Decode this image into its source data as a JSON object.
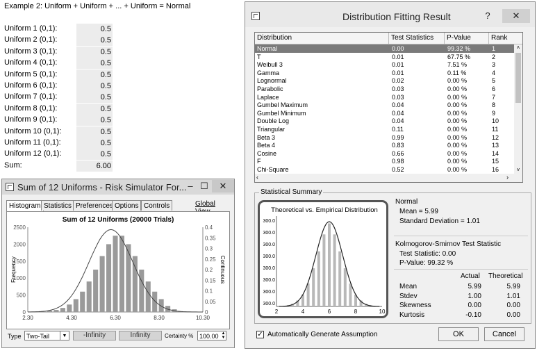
{
  "sheet": {
    "title": "Example 2: Uniform + Uniform + ... + Uniform = Normal",
    "rows": [
      {
        "label": "Uniform 1 (0,1):",
        "value": "0.5"
      },
      {
        "label": "Uniform 2 (0,1):",
        "value": "0.5"
      },
      {
        "label": "Uniform 3 (0,1):",
        "value": "0.5"
      },
      {
        "label": "Uniform 4 (0,1):",
        "value": "0.5"
      },
      {
        "label": "Uniform 5 (0,1):",
        "value": "0.5"
      },
      {
        "label": "Uniform 6 (0,1):",
        "value": "0.5"
      },
      {
        "label": "Uniform 7 (0,1):",
        "value": "0.5"
      },
      {
        "label": "Uniform 8 (0,1):",
        "value": "0.5"
      },
      {
        "label": "Uniform 9 (0,1):",
        "value": "0.5"
      },
      {
        "label": "Uniform 10 (0,1):",
        "value": "0.5"
      },
      {
        "label": "Uniform 11 (0,1):",
        "value": "0.5"
      },
      {
        "label": "Uniform 12 (0,1):",
        "value": "0.5"
      }
    ],
    "sum_label": "Sum:",
    "sum_value": "6.00"
  },
  "forecast": {
    "title": "Sum of 12 Uniforms - Risk Simulator For...",
    "minimize": "–",
    "maximize": "☐",
    "close": "✕",
    "tabs": [
      "Histogram",
      "Statistics",
      "Preferences",
      "Options",
      "Controls"
    ],
    "global_view": "Global View",
    "chart_title": "Sum of 12 Uniforms (20000 Trials)",
    "ylabel": "Frequency",
    "y2label": "Continuous",
    "yticks": [
      "2500",
      "2000",
      "1500",
      "1000",
      "500",
      "0"
    ],
    "y2ticks": [
      "0.4",
      "0.35",
      "0.3",
      "0.25",
      "0.2",
      "0.15",
      "0.1",
      "0.05",
      "0"
    ],
    "xticks": [
      "2.30",
      "4.30",
      "6.30",
      "8.30",
      "10.30"
    ],
    "type_label": "Type",
    "type_value": "Two-Tail",
    "lower_value": "-Infinity",
    "upper_value": "Infinity",
    "certainty_label": "Certainty %",
    "certainty_value": "100.00",
    "colors": {
      "bars": "#9a9a9a",
      "curve": "#444444"
    }
  },
  "fit": {
    "title": "Distribution Fitting Result",
    "help": "?",
    "close": "✕",
    "columns": [
      "Distribution",
      "Test Statistics",
      "P-Value",
      "Rank"
    ],
    "rows": [
      [
        "Normal",
        "0.00",
        "99.32 %",
        "1"
      ],
      [
        "T",
        "0.01",
        "67.75 %",
        "2"
      ],
      [
        "Weibull 3",
        "0.01",
        "7.51 %",
        "3"
      ],
      [
        "Gamma",
        "0.01",
        "0.11 %",
        "4"
      ],
      [
        "Lognormal",
        "0.02",
        "0.00 %",
        "5"
      ],
      [
        "Parabolic",
        "0.03",
        "0.00 %",
        "6"
      ],
      [
        "Laplace",
        "0.03",
        "0.00 %",
        "7"
      ],
      [
        "Gumbel Maximum",
        "0.04",
        "0.00 %",
        "8"
      ],
      [
        "Gumbel Minimum",
        "0.04",
        "0.00 %",
        "9"
      ],
      [
        "Double Log",
        "0.04",
        "0.00 %",
        "10"
      ],
      [
        "Triangular",
        "0.11",
        "0.00 %",
        "11"
      ],
      [
        "Beta 3",
        "0.99",
        "0.00 %",
        "12"
      ],
      [
        "Beta 4",
        "0.83",
        "0.00 %",
        "13"
      ],
      [
        "Cosine",
        "0.66",
        "0.00 %",
        "14"
      ],
      [
        "F",
        "0.98",
        "0.00 %",
        "15"
      ],
      [
        "Chi-Square",
        "0.52",
        "0.00 %",
        "16"
      ]
    ],
    "summary_label": "Statistical Summary",
    "chart_title": "Theoretical vs. Empirical Distribution",
    "chart_yticks": [
      "300.0",
      "300.0",
      "300.0",
      "300.0",
      "300.0",
      "300.0",
      "300.0",
      "300.0"
    ],
    "chart_xticks": [
      "2",
      "4",
      "6",
      "8",
      "10"
    ],
    "dist_name": "Normal",
    "mean_text": "Mean = 5.99",
    "sd_text": "Standard Deviation = 1.01",
    "ks_title": "Kolmogorov-Smirnov Test Statistic",
    "ks_stat": "Test Statistic: 0.00",
    "ks_pvalue": "P-Value: 99.32 %",
    "stats_header": [
      "Actual",
      "Theoretical"
    ],
    "stats": [
      {
        "label": "Mean",
        "actual": "5.99",
        "theoretical": "5.99"
      },
      {
        "label": "Stdev",
        "actual": "1.00",
        "theoretical": "1.01"
      },
      {
        "label": "Skewness",
        "actual": "0.00",
        "theoretical": "0.00"
      },
      {
        "label": "Kurtosis",
        "actual": "-0.10",
        "theoretical": "0.00"
      }
    ],
    "auto_assumption": "Automatically Generate Assumption",
    "auto_checked": true,
    "ok_label": "OK",
    "cancel_label": "Cancel"
  },
  "chart_data": [
    {
      "type": "bar",
      "title": "Sum of 12 Uniforms (20000 Trials)",
      "xlabel": "",
      "ylabel": "Frequency",
      "x": [
        3.3,
        3.6,
        3.9,
        4.2,
        4.5,
        4.8,
        5.1,
        5.4,
        5.7,
        6.0,
        6.3,
        6.6,
        6.9,
        7.2,
        7.5,
        7.8,
        8.1,
        8.4,
        8.7,
        9.0
      ],
      "values": [
        40,
        60,
        120,
        220,
        380,
        600,
        900,
        1250,
        1650,
        2000,
        2250,
        2250,
        2000,
        1650,
        1250,
        900,
        600,
        380,
        180,
        80
      ],
      "xlim": [
        2.3,
        10.3
      ],
      "ylim": [
        0,
        2500
      ],
      "overlay": "normal curve"
    },
    {
      "type": "bar",
      "title": "Theoretical vs. Empirical Distribution",
      "x": [
        3.2,
        3.6,
        4.0,
        4.4,
        4.8,
        5.2,
        5.6,
        6.0,
        6.4,
        6.8,
        7.2,
        7.6,
        8.0,
        8.4,
        8.8
      ],
      "values": [
        0.03,
        0.07,
        0.14,
        0.27,
        0.45,
        0.65,
        0.85,
        0.98,
        0.85,
        0.65,
        0.45,
        0.27,
        0.14,
        0.07,
        0.03
      ],
      "xlim": [
        2,
        10
      ],
      "overlay": "normal curve"
    }
  ]
}
